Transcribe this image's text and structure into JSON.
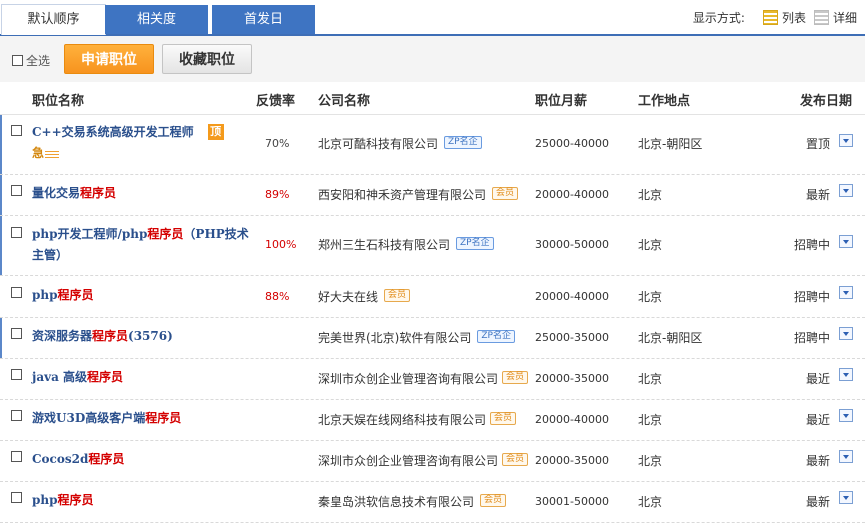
{
  "tabs": [
    {
      "label": "默认顺序",
      "active": true
    },
    {
      "label": "相关度",
      "active": false
    },
    {
      "label": "首发日",
      "active": false
    }
  ],
  "display_mode": {
    "label": "显示方式:",
    "list": "列表",
    "detail": "详细"
  },
  "actions": {
    "select_all": "全选",
    "apply": "申请职位",
    "favorite": "收藏职位"
  },
  "headers": {
    "title": "职位名称",
    "rate": "反馈率",
    "company": "公司名称",
    "salary": "职位月薪",
    "location": "工作地点",
    "date": "发布日期"
  },
  "badges": {
    "zp": "ZP名企",
    "vip": "会员"
  },
  "urgent": {
    "top": "顶",
    "ji": "急"
  },
  "rows": [
    {
      "title_a": "C++交易系统高级开发工程师",
      "title_kw": "",
      "title_b": "",
      "rate": "70%",
      "company": "北京可酷科技有限公司",
      "salary": "25000-40000",
      "location": "北京-朝阳区",
      "date": "置顶"
    },
    {
      "title_a": "量化交易",
      "title_kw": "程序员",
      "title_b": "",
      "rate": "89%",
      "company": "西安阳和神禾资产管理有限公司",
      "salary": "20000-40000",
      "location": "北京",
      "date": "最新"
    },
    {
      "title_a": "php开发工程师/php",
      "title_kw": "程序员",
      "title_b": "（PHP技术主管）",
      "rate": "100%",
      "company": "郑州三生石科技有限公司",
      "salary": "30000-50000",
      "location": "北京",
      "date": "招聘中"
    },
    {
      "title_a": "php",
      "title_kw": "程序员",
      "title_b": "",
      "rate": "88%",
      "company": "好大夫在线",
      "salary": "20000-40000",
      "location": "北京",
      "date": "招聘中"
    },
    {
      "title_a": "资深服务器",
      "title_kw": "程序员",
      "title_b": "(3576)",
      "rate": "",
      "company": "完美世界(北京)软件有限公司",
      "salary": "25000-35000",
      "location": "北京-朝阳区",
      "date": "招聘中"
    },
    {
      "title_a": "java 高级",
      "title_kw": "程序员",
      "title_b": "",
      "rate": "",
      "company": "深圳市众创企业管理咨询有限公司",
      "salary": "20000-35000",
      "location": "北京",
      "date": "最近"
    },
    {
      "title_a": "游戏U3D高级客户端",
      "title_kw": "程序员",
      "title_b": "",
      "rate": "",
      "company": "北京天娱在线网络科技有限公司",
      "salary": "20000-40000",
      "location": "北京",
      "date": "最近"
    },
    {
      "title_a": "Cocos2d",
      "title_kw": "程序员",
      "title_b": "",
      "rate": "",
      "company": "深圳市众创企业管理咨询有限公司",
      "salary": "20000-35000",
      "location": "北京",
      "date": "最新"
    },
    {
      "title_a": "php",
      "title_kw": "程序员",
      "title_b": "",
      "rate": "",
      "company": "秦皇岛洪软信息技术有限公司",
      "salary": "30001-50000",
      "location": "北京",
      "date": "最新"
    }
  ]
}
